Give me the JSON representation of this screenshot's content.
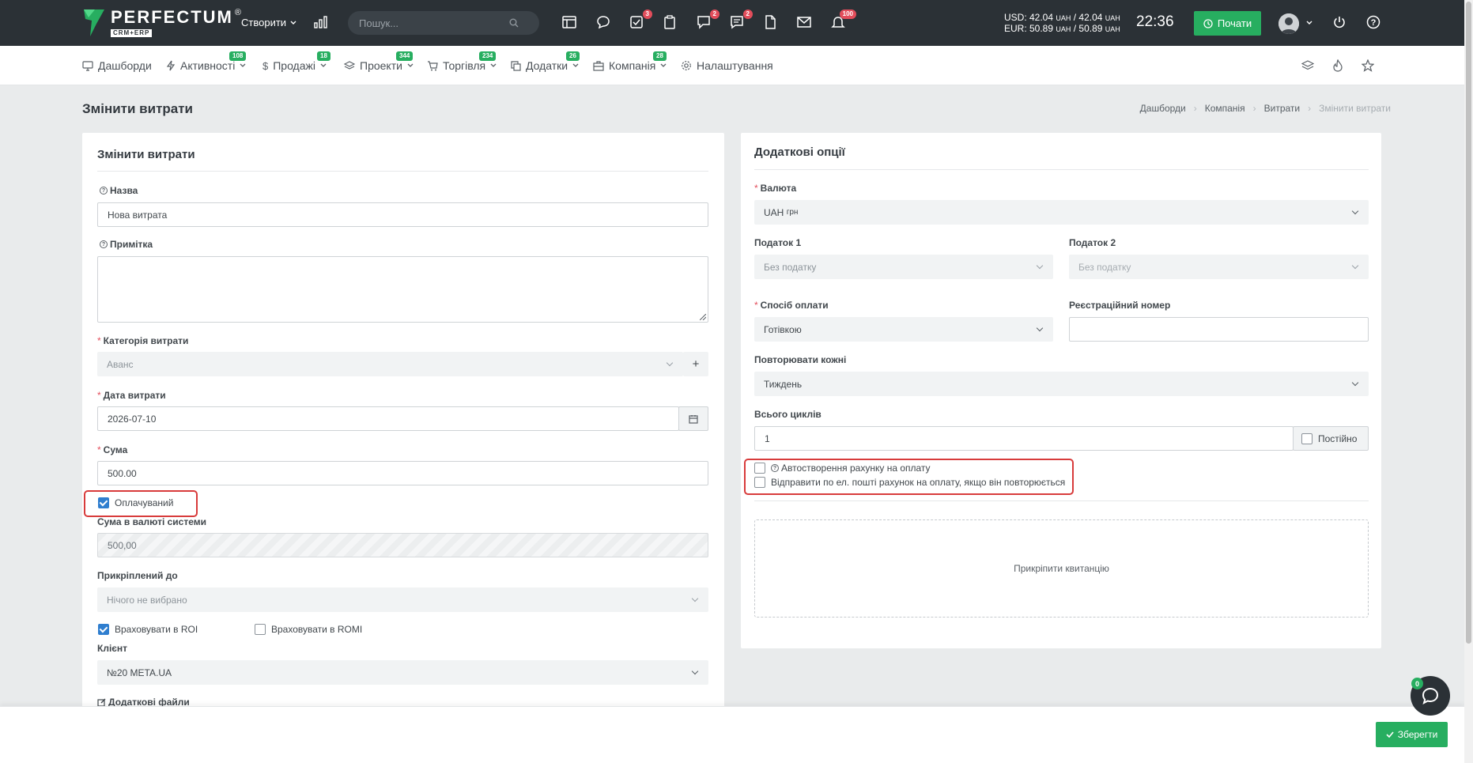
{
  "topbar": {
    "logo_text": "PERFECTUM",
    "logo_sub": "CRM+ERP",
    "logo_reg": "®",
    "create_label": "Створити",
    "search_placeholder": "Пошук...",
    "badges": {
      "tasks": "3",
      "chat": "2",
      "messages": "2",
      "notifications": "100"
    },
    "currency": {
      "usd_label": "USD: 42.04",
      "usd_unit1": "UAH",
      "usd_sep": "/ 42.04",
      "usd_unit2": "UAH",
      "eur_label": "EUR: 50.89",
      "eur_unit1": "UAH",
      "eur_sep": "/ 50.89",
      "eur_unit2": "UAH"
    },
    "clock": "22:36",
    "start_label": "Почати"
  },
  "nav": {
    "items": [
      {
        "label": "Дашборди",
        "badge": ""
      },
      {
        "label": "Активності",
        "badge": "108"
      },
      {
        "label": "Продажі",
        "badge": "18"
      },
      {
        "label": "Проекти",
        "badge": "344"
      },
      {
        "label": "Торгівля",
        "badge": "234"
      },
      {
        "label": "Додатки",
        "badge": "26"
      },
      {
        "label": "Компанія",
        "badge": "28"
      },
      {
        "label": "Налаштування",
        "badge": ""
      }
    ]
  },
  "page": {
    "title": "Змінити витрати",
    "breadcrumb": [
      "Дашборди",
      "Компанія",
      "Витрати",
      "Змінити витрати"
    ]
  },
  "left": {
    "title": "Змінити витрати",
    "name_label": "Назва",
    "name_value": "Нова витрата",
    "note_label": "Примітка",
    "category_label": "Категорія витрати",
    "category_value": "Аванс",
    "category_add": "+",
    "date_label": "Дата витрати",
    "date_value": "2026-07-10",
    "amount_label": "Сума",
    "amount_value": "500.00",
    "billable_label": "Оплачуваний",
    "billable_checked": true,
    "system_amount_label": "Сума в валюті системи",
    "system_amount_value": "500,00",
    "attached_label": "Прикріплений до",
    "attached_value": "Нічого не вибрано",
    "roi_label": "Враховувати в ROI",
    "roi_checked": true,
    "romi_label": "Враховувати в ROMI",
    "romi_checked": false,
    "client_label": "Клієнт",
    "client_value": "№20 META.UA",
    "files_label": "Додаткові файли"
  },
  "right": {
    "title": "Додаткові опції",
    "currency_label": "Валюта",
    "currency_value": "UAH",
    "currency_sub": "грн",
    "tax1_label": "Податок 1",
    "tax1_value": "Без податку",
    "tax2_label": "Податок 2",
    "tax2_value": "Без податку",
    "payment_label": "Спосіб оплати",
    "payment_value": "Готівкою",
    "regnum_label": "Реєстраційний номер",
    "regnum_value": "",
    "repeat_label": "Повторювати кожні",
    "repeat_value": "Тиждень",
    "cycles_label": "Всього циклів",
    "cycles_value": "1",
    "permanent_label": "Постійно",
    "auto_invoice_label": "Автостворення рахунку на оплату",
    "email_invoice_label": "Відправити по ел. пошті рахунок на оплату, якщо він повторюється",
    "dropzone_label": "Прикріпити квитанцію"
  },
  "footer": {
    "save_label": "Зберегти",
    "chat_badge": "0"
  },
  "colors": {
    "accent_green": "#27ae60",
    "topbar": "#2b3136",
    "highlight_red": "#d83b3b",
    "checkbox_blue": "#2f7ecf"
  }
}
